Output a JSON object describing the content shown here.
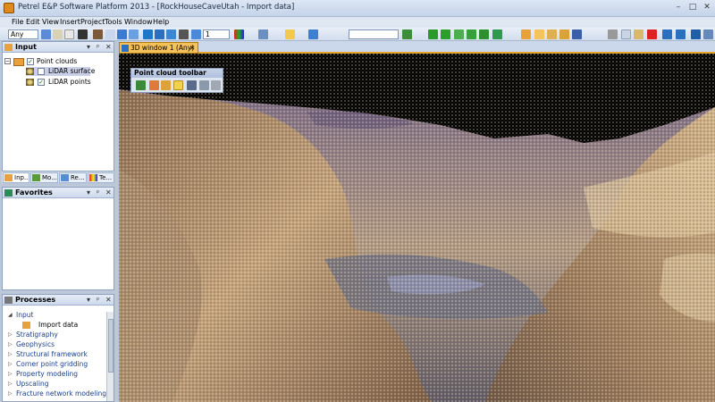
{
  "window": {
    "title": "Petrel E&P Software Platform 2013 - [RockHouseCaveUtah - Import data]",
    "min_glyph": "–",
    "max_glyph": "□",
    "close_glyph": "✕"
  },
  "menu": [
    "File",
    "Edit",
    "View",
    "Insert",
    "Project",
    "Tools",
    "Window",
    "Help"
  ],
  "toolbar": {
    "domain_value": "Any",
    "number_value": "1",
    "search_value": ""
  },
  "input_panel": {
    "title": "Input",
    "tree": {
      "root_label": "Point clouds",
      "children": [
        {
          "label": "LiDAR surface",
          "checked": false
        },
        {
          "label": "LiDAR points",
          "checked": true
        }
      ]
    },
    "tabs": [
      "Inp...",
      "Mo...",
      "Re...",
      "Te..."
    ]
  },
  "favorites_panel": {
    "title": "Favorites"
  },
  "processes_panel": {
    "title": "Processes",
    "items": [
      {
        "label": "Input",
        "expanded": true
      },
      {
        "label": "Import data",
        "child": true
      },
      {
        "label": "Stratigraphy"
      },
      {
        "label": "Geophysics"
      },
      {
        "label": "Structural framework"
      },
      {
        "label": "Corner point gridding"
      },
      {
        "label": "Property modeling"
      },
      {
        "label": "Upscaling"
      },
      {
        "label": "Fracture network modeling"
      }
    ]
  },
  "viewer": {
    "tab_label": "3D window 1 (Any)",
    "tab_close": "✕",
    "point_cloud_toolbar_title": "Point cloud toolbar"
  },
  "colors": {
    "accent": "#f5c15a",
    "panel_title_bg": "#d6e0ef",
    "process_link": "#1a3f8a"
  },
  "icons": [
    "app-icon",
    "folder-icon",
    "point-cloud-icon",
    "star-icon",
    "gear-icon",
    "close-icon",
    "pin-icon",
    "dropdown-icon"
  ]
}
